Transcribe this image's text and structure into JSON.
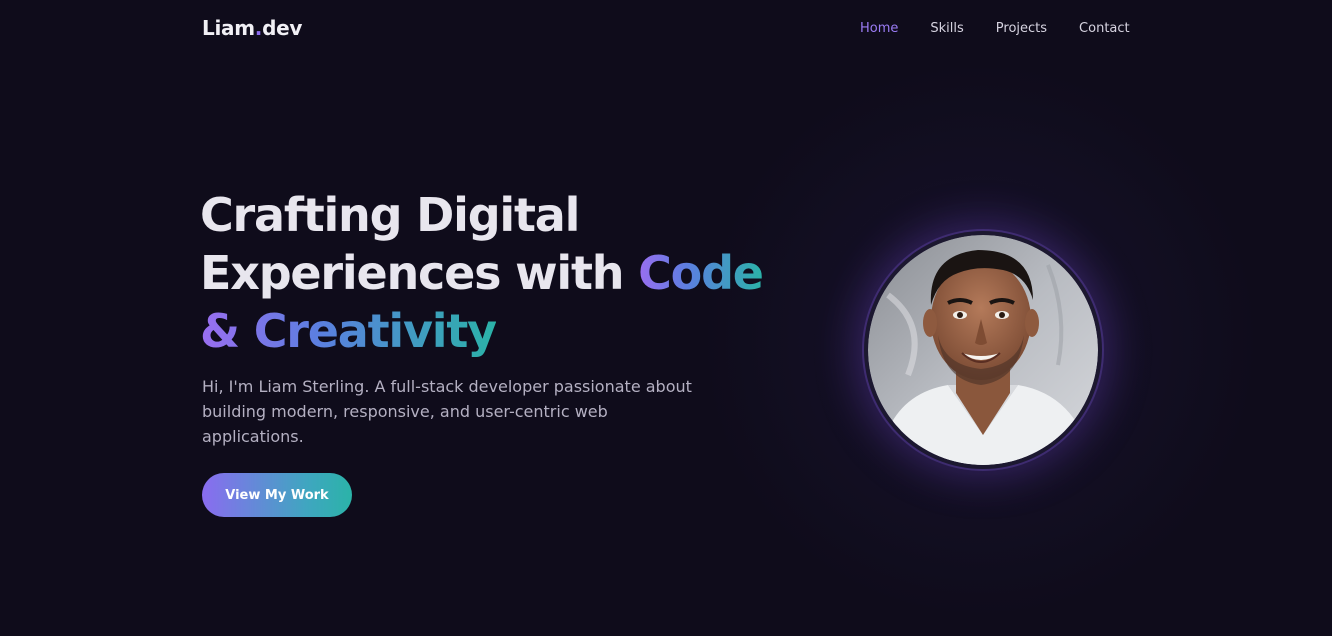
{
  "brand": {
    "name": "Liam",
    "dot": ".",
    "suffix": "dev"
  },
  "nav": {
    "items": [
      {
        "label": "Home",
        "active": true
      },
      {
        "label": "Skills",
        "active": false
      },
      {
        "label": "Projects",
        "active": false
      },
      {
        "label": "Contact",
        "active": false
      }
    ]
  },
  "hero": {
    "title_line1": "Crafting Digital",
    "title_line2_plain": "Experiences with ",
    "title_line2_accent": "Code",
    "title_line3_accent": "& Creativity",
    "subtitle": "Hi, I'm Liam Sterling. A full-stack developer passionate about building modern, responsive, and user-centric web applications.",
    "cta_label": "View My Work"
  },
  "colors": {
    "background": "#0f0c1b",
    "accent_purple": "#9b7cf5",
    "accent_teal": "#2bb3a8"
  },
  "avatar": {
    "icon": "profile-photo"
  }
}
